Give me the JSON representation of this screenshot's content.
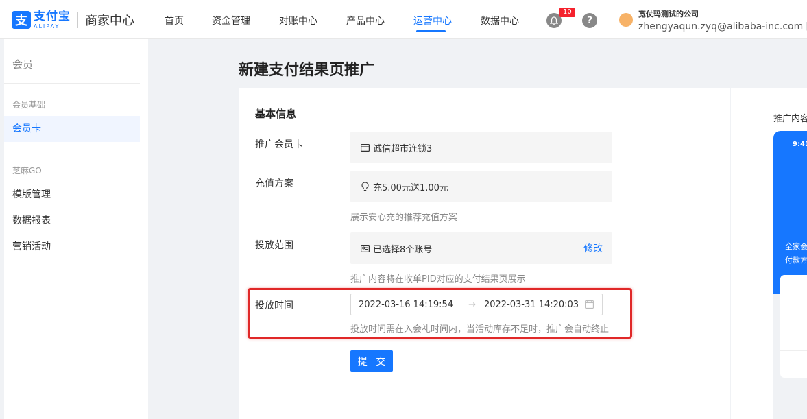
{
  "brand": {
    "logo_char": "支",
    "name_cn": "支付宝",
    "name_en": "ALIPAY",
    "subtitle": "商家中心"
  },
  "nav": {
    "items": [
      "首页",
      "资金管理",
      "对账中心",
      "产品中心",
      "运营中心",
      "数据中心"
    ],
    "active": "运营中心",
    "notification_count": "10",
    "help_label": "?"
  },
  "user": {
    "company": "宽仗玛测试的公司",
    "email": "zhengyaqun.zyq@alibaba-inc.com [主账"
  },
  "sidebar": {
    "header": "会员",
    "group1": "会员基础",
    "item_member_card": "会员卡",
    "group2": "芝麻GO",
    "item_templates": "模版管理",
    "item_reports": "数据报表",
    "item_campaigns": "营销活动"
  },
  "page": {
    "title": "新建支付结果页推广"
  },
  "form": {
    "section_title": "基本信息",
    "card_label": "推广会员卡",
    "card_value": "诚信超市连锁3",
    "plan_label": "充值方案",
    "plan_value": "充5.00元送1.00元",
    "plan_hint": "展示安心充的推荐充值方案",
    "scope_label": "投放范围",
    "scope_value": "已选择8个账号",
    "scope_edit": "修改",
    "scope_hint": "推广内容将在收单PID对应的支付结果页展示",
    "time_label": "投放时间",
    "time_start": "2022-03-16 14:19:54",
    "time_arrow": "→",
    "time_end": "2022-03-31 14:20:03",
    "time_hint": "投放时间需在入会礼时间内，当活动库存不足时，推广会自动终止",
    "submit_label": "提 交"
  },
  "preview": {
    "label": "推广内容",
    "phone_time": "9:41",
    "text1": "全家会",
    "text2": "付款方"
  },
  "colors": {
    "accent": "#1677ff",
    "highlight": "#e02828"
  }
}
